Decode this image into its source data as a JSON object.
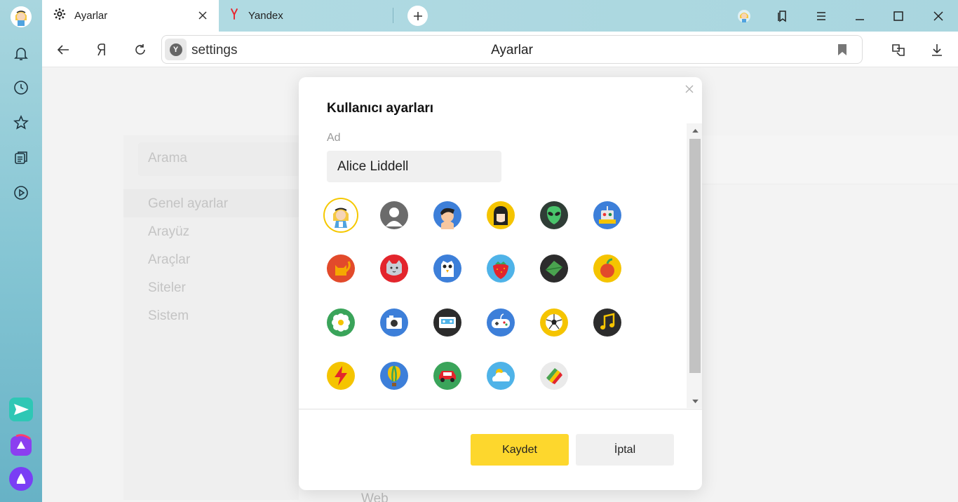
{
  "browser": {
    "tabs": [
      {
        "title": "Ayarlar",
        "icon": "gear-icon",
        "active": true
      },
      {
        "title": "Yandex",
        "icon": "yandex-logo-icon",
        "active": false
      }
    ],
    "omnibox": {
      "url": "settings",
      "title": "Ayarlar"
    }
  },
  "page": {
    "search_placeholder": "Arama",
    "nav": [
      {
        "label": "Genel ayarlar",
        "selected": true
      },
      {
        "label": "Arayüz"
      },
      {
        "label": "Araçlar"
      },
      {
        "label": "Siteler"
      },
      {
        "label": "Sistem"
      }
    ],
    "footer_partial": "Web"
  },
  "dialog": {
    "title": "Kullanıcı ayarları",
    "name_label": "Ad",
    "name_value": "Alice Liddell",
    "avatars": [
      "alice",
      "silhouette",
      "boy",
      "girl",
      "alien",
      "robot",
      "cat",
      "kitten",
      "owl",
      "strawberry",
      "leaf",
      "apple",
      "flower",
      "camera",
      "cassette",
      "gamepad",
      "soccer-ball",
      "music-note",
      "lightning",
      "balloon",
      "car",
      "cloud",
      "colors"
    ],
    "selected_avatar": "alice",
    "save_label": "Kaydet",
    "cancel_label": "İptal"
  },
  "colors": {
    "accent": "#fdd72d",
    "sidebar_top": "#a9d6df",
    "sidebar_bottom": "#67b2c6"
  }
}
